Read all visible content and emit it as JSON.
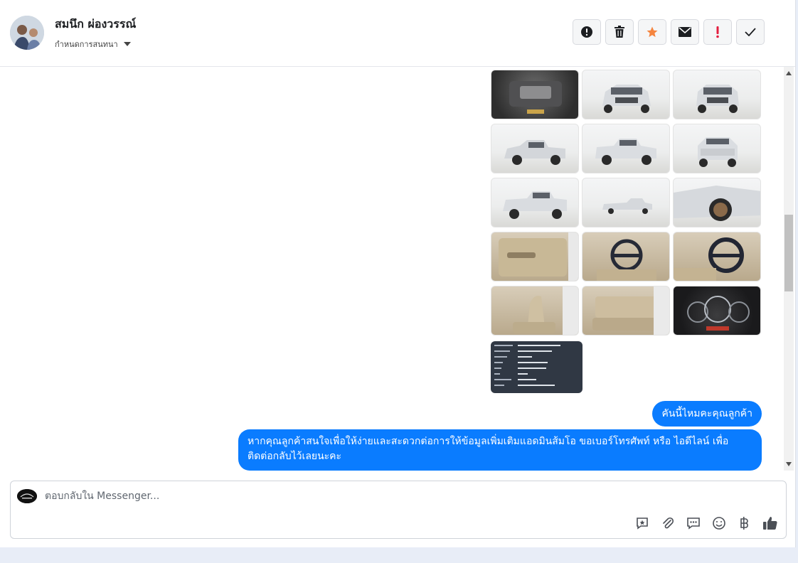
{
  "header": {
    "contact_name": "สมนึก ผ่องวรรณ์",
    "assign_label": "กำหนดการสนทนา",
    "actions": [
      {
        "name": "spam-button",
        "icon": "alert-circle-icon"
      },
      {
        "name": "delete-button",
        "icon": "trash-icon"
      },
      {
        "name": "star-button",
        "icon": "star-icon"
      },
      {
        "name": "mark-unread-button",
        "icon": "envelope-icon"
      },
      {
        "name": "follow-up-button",
        "icon": "exclamation-icon"
      },
      {
        "name": "mark-done-button",
        "icon": "checkmark-icon"
      }
    ]
  },
  "colors": {
    "accent": "#0a7cff",
    "star": "#f5853f",
    "follow_up": "#e41e3f"
  },
  "thread": {
    "photos": [
      "engine",
      "front",
      "front",
      "front-left",
      "rear-right",
      "rear",
      "rear-left",
      "side",
      "front-wheel",
      "door-panel",
      "steering-wheel",
      "steering-wheel",
      "front-seats",
      "rear-seats",
      "dashboard"
    ],
    "messages": [
      {
        "text": "คันนี้ไหมคะคุณลูกค้า"
      },
      {
        "text": "หากคุณลูกค้าสนใจเพื่อให้ง่ายและสะดวกต่อการให้ข้อมูลเพิ่มเติมแอดมินส้มโอ ขอเบอร์โทรศัพท์ หรือ ไอดีไลน์ เพื่อติดต่อกลับไว้เลยนะคะ"
      }
    ]
  },
  "composer": {
    "placeholder": "ตอบกลับใน Messenger...",
    "tools": [
      "saved-reply-icon",
      "attachment-icon",
      "chat-bubble-icon",
      "emoji-icon",
      "baht-icon",
      "thumbs-up-icon"
    ]
  }
}
